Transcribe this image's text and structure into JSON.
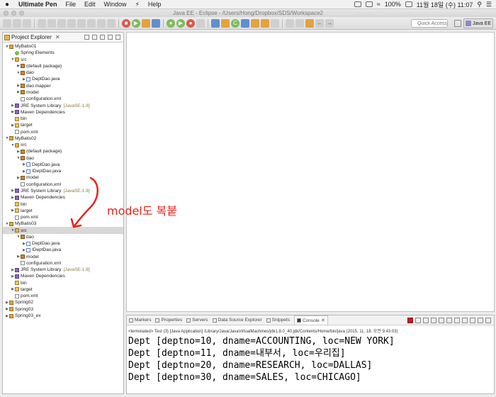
{
  "menubar": {
    "app_name": "Ultimate Pen",
    "items": [
      "File",
      "Edit",
      "Window",
      "Help"
    ],
    "battery": "100%",
    "datetime": "11월 18일 (수)  11:07"
  },
  "window": {
    "title": "Java EE - Eclipse - /Users/Hong/Dropbox/SDS/Workspace2"
  },
  "toolbar": {
    "quick_access_placeholder": "Quick Access",
    "perspective_label": "Java EE"
  },
  "explorer": {
    "tab_label": "Project Explorer",
    "tree": [
      {
        "label": "MyBatis01",
        "level": 0,
        "type": "proj",
        "twisty": "open"
      },
      {
        "label": "Spring Elements",
        "level": 1,
        "type": "spring",
        "twisty": ""
      },
      {
        "label": "src",
        "level": 1,
        "type": "src",
        "twisty": "open"
      },
      {
        "label": "(default package)",
        "level": 2,
        "type": "pkg",
        "twisty": "closed"
      },
      {
        "label": "dao",
        "level": 2,
        "type": "pkg",
        "twisty": "open"
      },
      {
        "label": "DeptDao.java",
        "level": 3,
        "type": "java",
        "twisty": "closed"
      },
      {
        "label": "dao.mapper",
        "level": 2,
        "type": "pkg",
        "twisty": "closed"
      },
      {
        "label": "model",
        "level": 2,
        "type": "pkg",
        "twisty": "closed"
      },
      {
        "label": "configuration.xml",
        "level": 2,
        "type": "xml",
        "twisty": ""
      },
      {
        "label": "JRE System Library",
        "suffix": "[JavaSE-1.8]",
        "level": 1,
        "type": "lib",
        "twisty": "closed"
      },
      {
        "label": "Maven Dependencies",
        "level": 1,
        "type": "lib",
        "twisty": "closed"
      },
      {
        "label": "bin",
        "level": 1,
        "type": "folder",
        "twisty": ""
      },
      {
        "label": "target",
        "level": 1,
        "type": "folder",
        "twisty": "closed"
      },
      {
        "label": "pom.xml",
        "level": 1,
        "type": "xml",
        "twisty": ""
      },
      {
        "label": "MyBatis02",
        "level": 0,
        "type": "proj",
        "twisty": "open"
      },
      {
        "label": "src",
        "level": 1,
        "type": "src",
        "twisty": "open"
      },
      {
        "label": "(default package)",
        "level": 2,
        "type": "pkg",
        "twisty": "closed"
      },
      {
        "label": "dao",
        "level": 2,
        "type": "pkg",
        "twisty": "open"
      },
      {
        "label": "DeptDao.java",
        "level": 3,
        "type": "java",
        "twisty": "closed"
      },
      {
        "label": "IDeptDao.java",
        "level": 3,
        "type": "java",
        "twisty": "closed"
      },
      {
        "label": "model",
        "level": 2,
        "type": "pkg",
        "twisty": "closed"
      },
      {
        "label": "configuration.xml",
        "level": 2,
        "type": "xml",
        "twisty": ""
      },
      {
        "label": "JRE System Library",
        "suffix": "[JavaSE-1.8]",
        "level": 1,
        "type": "lib",
        "twisty": "closed"
      },
      {
        "label": "Maven Dependencies",
        "level": 1,
        "type": "lib",
        "twisty": "closed"
      },
      {
        "label": "bin",
        "level": 1,
        "type": "folder",
        "twisty": ""
      },
      {
        "label": "target",
        "level": 1,
        "type": "folder",
        "twisty": "closed"
      },
      {
        "label": "pom.xml",
        "level": 1,
        "type": "xml",
        "twisty": ""
      },
      {
        "label": "MyBatis03",
        "level": 0,
        "type": "proj",
        "twisty": "open"
      },
      {
        "label": "src",
        "level": 1,
        "type": "src",
        "twisty": "open",
        "selected": true
      },
      {
        "label": "dao",
        "level": 2,
        "type": "pkg",
        "twisty": "open"
      },
      {
        "label": "DeptDao.java",
        "level": 3,
        "type": "java",
        "twisty": "closed"
      },
      {
        "label": "IDeptDao.java",
        "level": 3,
        "type": "java",
        "twisty": "closed"
      },
      {
        "label": "model",
        "level": 2,
        "type": "pkg",
        "twisty": "closed"
      },
      {
        "label": "configuration.xml",
        "level": 2,
        "type": "xml",
        "twisty": ""
      },
      {
        "label": "JRE System Library",
        "suffix": "[JavaSE-1.8]",
        "level": 1,
        "type": "lib",
        "twisty": "closed"
      },
      {
        "label": "Maven Dependencies",
        "level": 1,
        "type": "lib",
        "twisty": "closed"
      },
      {
        "label": "bin",
        "level": 1,
        "type": "folder",
        "twisty": ""
      },
      {
        "label": "target",
        "level": 1,
        "type": "folder",
        "twisty": "closed"
      },
      {
        "label": "pom.xml",
        "level": 1,
        "type": "xml",
        "twisty": ""
      },
      {
        "label": "Spring02",
        "level": 0,
        "type": "proj",
        "twisty": "closed"
      },
      {
        "label": "Spring03",
        "level": 0,
        "type": "proj",
        "twisty": "closed"
      },
      {
        "label": "Spring03_ex",
        "level": 0,
        "type": "proj",
        "twisty": "closed"
      }
    ]
  },
  "annotation": {
    "text": "model도 복붙",
    "color": "#e8231a"
  },
  "console": {
    "tabs": [
      {
        "label": "Markers",
        "active": false
      },
      {
        "label": "Properties",
        "active": false
      },
      {
        "label": "Servers",
        "active": false
      },
      {
        "label": "Data Source Explorer",
        "active": false
      },
      {
        "label": "Snippets",
        "active": false
      },
      {
        "label": "Console",
        "active": true
      }
    ],
    "status": "<terminated> Test (3) [Java Application] /Library/Java/JavaVirtualMachines/jdk1.8.0_40.jdk/Contents/Home/bin/java (2015. 11. 18. 오전 9:43:03)",
    "lines": [
      "Dept [deptno=10, dname=ACCOUNTING, loc=NEW YORK]",
      "Dept [deptno=11, dname=내부서, loc=우리집]",
      "Dept [deptno=20, dname=RESEARCH, loc=DALLAS]",
      "Dept [deptno=30, dname=SALES, loc=CHICAGO]"
    ]
  }
}
